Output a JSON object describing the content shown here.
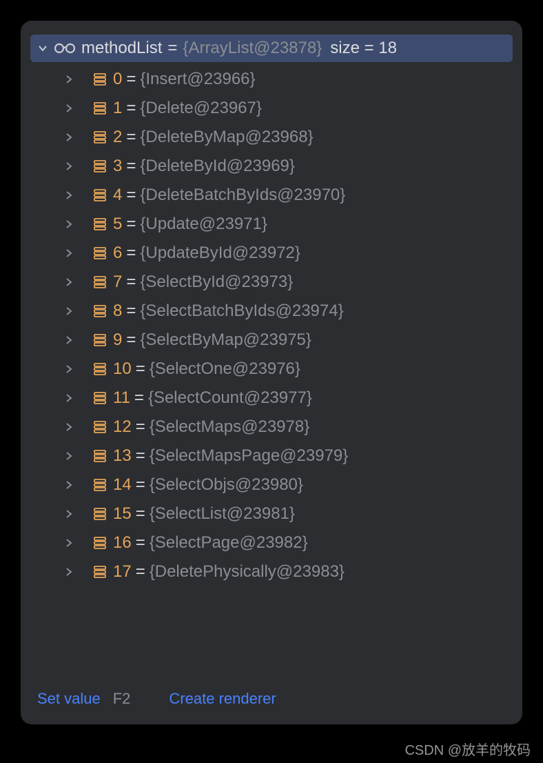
{
  "root": {
    "name": "methodList",
    "equals": "=",
    "type": "{ArrayList@23878}",
    "sizeLabel": "size = 18"
  },
  "items": [
    {
      "index": "0",
      "value": "{Insert@23966}"
    },
    {
      "index": "1",
      "value": "{Delete@23967}"
    },
    {
      "index": "2",
      "value": "{DeleteByMap@23968}"
    },
    {
      "index": "3",
      "value": "{DeleteById@23969}"
    },
    {
      "index": "4",
      "value": "{DeleteBatchByIds@23970}"
    },
    {
      "index": "5",
      "value": "{Update@23971}"
    },
    {
      "index": "6",
      "value": "{UpdateById@23972}"
    },
    {
      "index": "7",
      "value": "{SelectById@23973}"
    },
    {
      "index": "8",
      "value": "{SelectBatchByIds@23974}"
    },
    {
      "index": "9",
      "value": "{SelectByMap@23975}"
    },
    {
      "index": "10",
      "value": "{SelectOne@23976}"
    },
    {
      "index": "11",
      "value": "{SelectCount@23977}"
    },
    {
      "index": "12",
      "value": "{SelectMaps@23978}"
    },
    {
      "index": "13",
      "value": "{SelectMapsPage@23979}"
    },
    {
      "index": "14",
      "value": "{SelectObjs@23980}"
    },
    {
      "index": "15",
      "value": "{SelectList@23981}"
    },
    {
      "index": "16",
      "value": "{SelectPage@23982}"
    },
    {
      "index": "17",
      "value": "{DeletePhysically@23983}"
    }
  ],
  "footer": {
    "setValue": "Set value",
    "shortcut": "F2",
    "createRenderer": "Create renderer"
  },
  "watermark": "CSDN @放羊的牧码",
  "colors": {
    "panelBg": "#2b2d30",
    "selectedBg": "#3d4b6e",
    "index": "#e5a55a",
    "muted": "#8a8e93",
    "text": "#dcdde0",
    "link": "#4a82ff"
  }
}
